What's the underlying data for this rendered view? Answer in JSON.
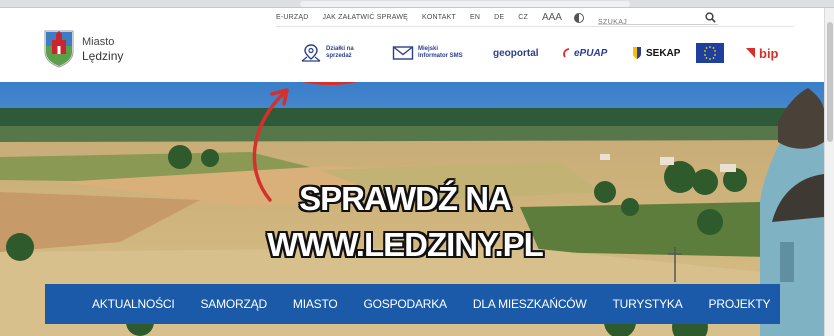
{
  "topbar": {
    "links": [
      "E-URZĄD",
      "JAK ZAŁATWIĆ SPRAWĘ",
      "KONTAKT",
      "EN",
      "DE",
      "CZ"
    ],
    "font_size_label": "AAA",
    "search_placeholder": "SZUKAJ"
  },
  "logo": {
    "line1": "Miasto",
    "line2": "Lędziny"
  },
  "services": {
    "dzialki": {
      "line1": "Działki na",
      "line2": "sprzedaż"
    },
    "informator": {
      "line1": "Miejski",
      "line2": "Informator SMS"
    },
    "geoportal": "geoportal",
    "epuap": "ePUAP",
    "sekap": "SEKAP",
    "bip": "bip"
  },
  "annotation": {
    "line1": "SPRAWDŹ NA",
    "line2": "WWW.LEDZINY.PL",
    "circle_color": "#d6302d"
  },
  "mainnav": {
    "items": [
      "AKTUALNOŚCI",
      "SAMORZĄD",
      "MIASTO",
      "GOSPODARKA",
      "DLA MIESZKAŃCÓW",
      "TURYSTYKA",
      "PROJEKTY"
    ]
  },
  "colors": {
    "brand_blue": "#2c3f8f",
    "nav_blue": "#1b5aa8",
    "annotation_red": "#d6302d"
  }
}
